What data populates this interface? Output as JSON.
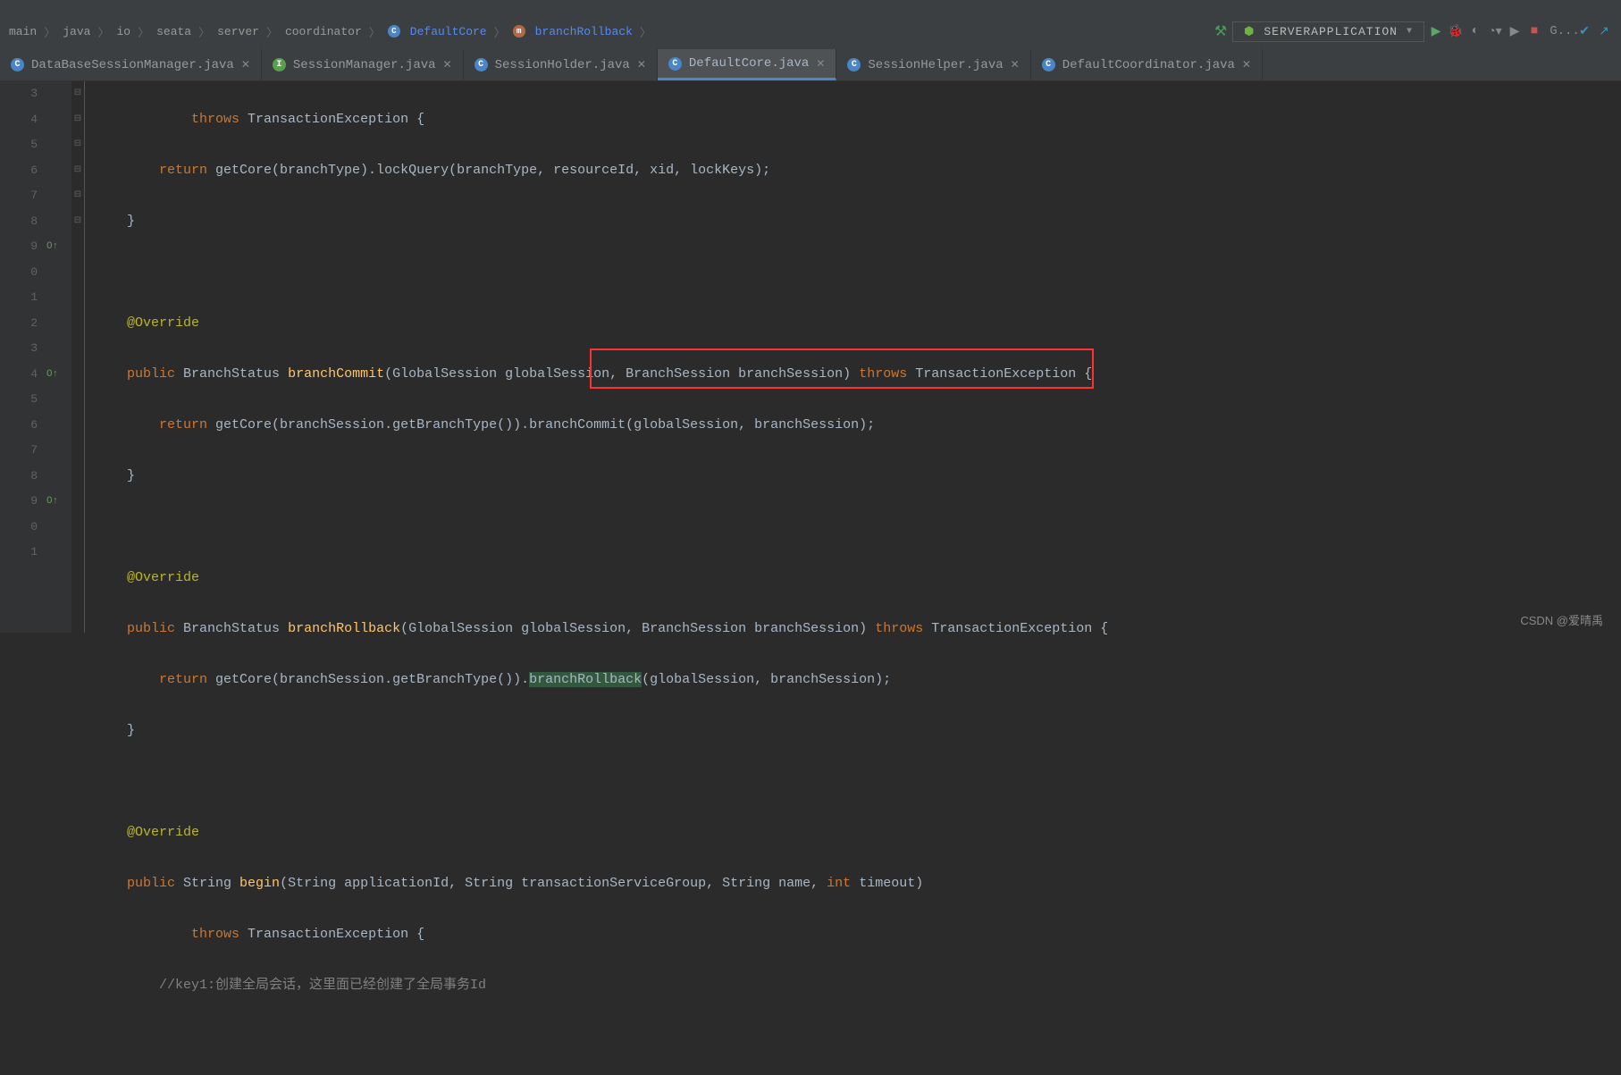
{
  "breadcrumbs": [
    "main",
    "java",
    "io",
    "seata",
    "server",
    "coordinator"
  ],
  "breadcrumb_class": "DefaultCore",
  "breadcrumb_method": "branchRollback",
  "run_config": "SERVERAPPLICATION",
  "tool_git": "G...",
  "tabs": [
    {
      "icon": "c",
      "label": "DataBaseSessionManager.java",
      "active": false
    },
    {
      "icon": "i",
      "label": "SessionManager.java",
      "active": false
    },
    {
      "icon": "c",
      "label": "SessionHolder.java",
      "active": false
    },
    {
      "icon": "c",
      "label": "DefaultCore.java",
      "active": true
    },
    {
      "icon": "c",
      "label": "SessionHelper.java",
      "active": false
    },
    {
      "icon": "c",
      "label": "DefaultCoordinator.java",
      "active": false
    }
  ],
  "line_numbers": [
    "3",
    "4",
    "5",
    "6",
    "7",
    "8",
    "9",
    "0",
    "1",
    "2",
    "3",
    "4",
    "5",
    "6",
    "7",
    "8",
    "9",
    "0",
    "1"
  ],
  "code_lines": {
    "l0_indent": "           ",
    "l0_kw": "throws",
    "l0_rest": " TransactionException {",
    "l1_indent": "       ",
    "l1_kw": "return",
    "l1_rest": " getCore(branchType).lockQuery(branchType, resourceId, xid, lockKeys);",
    "l2": "   }",
    "l4_indent": "   ",
    "l4_ann": "@Override",
    "l5_indent": "   ",
    "l5_kw1": "public",
    "l5_typ1": " BranchStatus ",
    "l5_mtd": "branchCommit",
    "l5_params": "(GlobalSession globalSession, BranchSession branchSession) ",
    "l5_kw2": "throws",
    "l5_rest": " TransactionException {",
    "l6_indent": "       ",
    "l6_kw": "return",
    "l6_rest": " getCore(branchSession.getBranchType()).branchCommit(globalSession, branchSession);",
    "l7": "   }",
    "l9_indent": "   ",
    "l9_ann": "@Override",
    "l10_indent": "   ",
    "l10_kw1": "public",
    "l10_typ1": " BranchStatus ",
    "l10_mtd": "branchRollback",
    "l10_params": "(GlobalSession globalSession, BranchSession branchSession) ",
    "l10_kw2": "throws",
    "l10_rest": " TransactionException {",
    "l11_indent": "       ",
    "l11_kw": "return",
    "l11_rest1": " getCore(branchSession.getBranchType()).",
    "l11_hl": "branchRollback",
    "l11_rest2": "(globalSession, branchSession);",
    "l12": "   }",
    "l14_indent": "   ",
    "l14_ann": "@Override",
    "l15_indent": "   ",
    "l15_kw1": "public",
    "l15_typ1": " String ",
    "l15_mtd": "begin",
    "l15_params": "(String applicationId, String transactionServiceGroup, String name, ",
    "l15_kw2": "int",
    "l15_rest": " timeout)",
    "l16_indent": "           ",
    "l16_kw": "throws",
    "l16_rest": " TransactionException {",
    "l17_indent": "       ",
    "l17_cmt": "//key1:创建全局会话，这里面已经创建了全局事务Id"
  },
  "watermark": "CSDN @爱晴禹"
}
